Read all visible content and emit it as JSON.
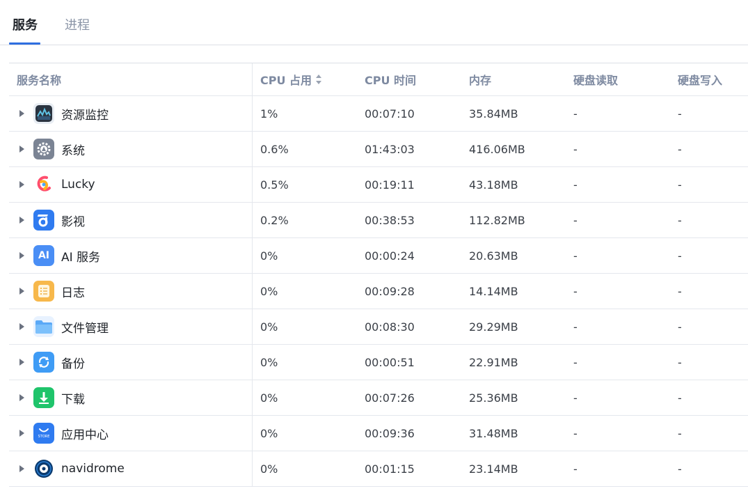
{
  "tabs": [
    {
      "label": "服务",
      "active": true
    },
    {
      "label": "进程",
      "active": false
    }
  ],
  "columns": {
    "name": "服务名称",
    "cpu": "CPU 占用",
    "cpu_time": "CPU 时间",
    "memory": "内存",
    "disk_read": "硬盘读取",
    "disk_write": "硬盘写入"
  },
  "rows": [
    {
      "name": "资源监控",
      "icon": "resource-monitor-icon",
      "cpu": "1%",
      "cpu_time": "00:07:10",
      "memory": "35.84MB",
      "disk_read": "-",
      "disk_write": "-"
    },
    {
      "name": "系统",
      "icon": "system-gear-icon",
      "cpu": "0.6%",
      "cpu_time": "01:43:03",
      "memory": "416.06MB",
      "disk_read": "-",
      "disk_write": "-"
    },
    {
      "name": "Lucky",
      "icon": "lucky-icon",
      "cpu": "0.5%",
      "cpu_time": "00:19:11",
      "memory": "43.18MB",
      "disk_read": "-",
      "disk_write": "-"
    },
    {
      "name": "影视",
      "icon": "video-icon",
      "cpu": "0.2%",
      "cpu_time": "00:38:53",
      "memory": "112.82MB",
      "disk_read": "-",
      "disk_write": "-"
    },
    {
      "name": "AI 服务",
      "icon": "ai-icon",
      "cpu": "0%",
      "cpu_time": "00:00:24",
      "memory": "20.63MB",
      "disk_read": "-",
      "disk_write": "-"
    },
    {
      "name": "日志",
      "icon": "log-icon",
      "cpu": "0%",
      "cpu_time": "00:09:28",
      "memory": "14.14MB",
      "disk_read": "-",
      "disk_write": "-"
    },
    {
      "name": "文件管理",
      "icon": "folder-icon",
      "cpu": "0%",
      "cpu_time": "00:08:30",
      "memory": "29.29MB",
      "disk_read": "-",
      "disk_write": "-"
    },
    {
      "name": "备份",
      "icon": "backup-icon",
      "cpu": "0%",
      "cpu_time": "00:00:51",
      "memory": "22.91MB",
      "disk_read": "-",
      "disk_write": "-"
    },
    {
      "name": "下载",
      "icon": "download-icon",
      "cpu": "0%",
      "cpu_time": "00:07:26",
      "memory": "25.36MB",
      "disk_read": "-",
      "disk_write": "-"
    },
    {
      "name": "应用中心",
      "icon": "app-store-icon",
      "cpu": "0%",
      "cpu_time": "00:09:36",
      "memory": "31.48MB",
      "disk_read": "-",
      "disk_write": "-"
    },
    {
      "name": "navidrome",
      "icon": "navidrome-icon",
      "cpu": "0%",
      "cpu_time": "00:01:15",
      "memory": "23.14MB",
      "disk_read": "-",
      "disk_write": "-"
    }
  ],
  "icon_texts": {
    "ai": "AI",
    "store": "STORE"
  },
  "colors": {
    "accent": "#2f6fe0",
    "header_text": "#7e8aa1"
  }
}
